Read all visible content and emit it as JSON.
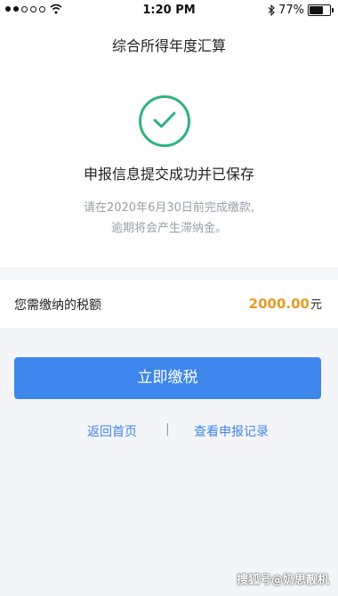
{
  "status_bar": {
    "time": "1:20 PM",
    "battery": "77%",
    "battery_level": 0.77
  },
  "page": {
    "title": "综合所得年度汇算",
    "success_message": "申报信息提交成功并已保存",
    "note_line1": "请在2020年6月30日前完成缴款,",
    "note_line2": "逾期将会产生滞纳金。"
  },
  "amount": {
    "label": "您需缴纳的税额",
    "value": "2000.00",
    "unit": "元"
  },
  "actions": {
    "pay_label": "立即缴税",
    "home_label": "返回首页",
    "separator": "|",
    "record_label": "查看申报记录"
  },
  "watermark": "搜狐号@奶思靓机",
  "colors": {
    "success": "#2fb37c",
    "primary": "#3f86ec",
    "amount": "#e99a24"
  },
  "icons": [
    "signal-dots-icon",
    "wifi-icon",
    "bluetooth-icon",
    "battery-icon",
    "success-check-icon"
  ]
}
